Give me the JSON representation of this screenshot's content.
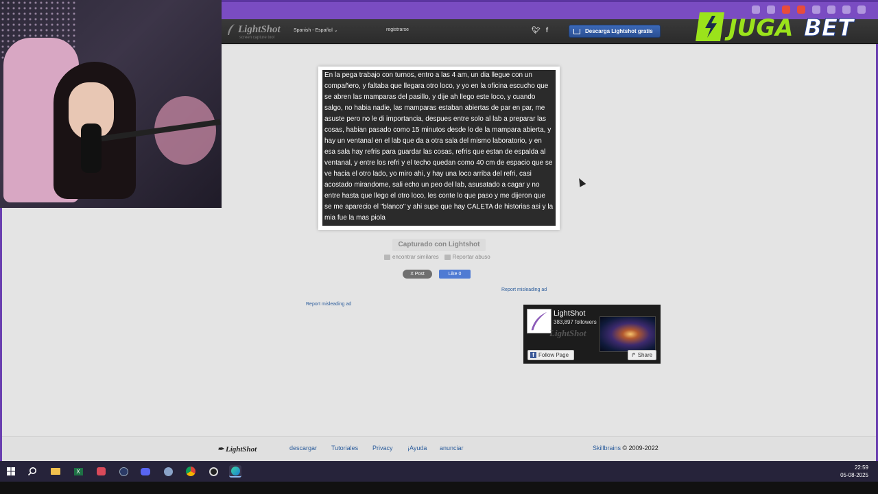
{
  "header": {
    "logo_name": "LightShot",
    "logo_sub": "screen capture tool",
    "language": "Spanish - Español",
    "register": "registrarse",
    "twitter_icon": "twitter-icon",
    "facebook_icon": "facebook-icon",
    "download_label": "Descarga Lightshot gratis"
  },
  "sponsor": {
    "name_left": "JUGA",
    "name_right": "BET"
  },
  "screenshot": {
    "text": "En la pega trabajo con turnos, entro a las 4 am, un dia llegue con un compañero, y faltaba que llegara otro loco, y  yo en la oficina escucho que se abren las mamparas del pasillo, y dije ah llego este loco, y cuando salgo, no habia nadie, las mamparas estaban abiertas de par en par, me asuste pero no le di importancia, despues entre solo al lab a preparar las cosas, habian pasado como 15 minutos desde lo de la mampara abierta,  y hay un ventanal en el lab que da a otra sala del mismo laboratorio, y en esa sala hay refris para guardar las cosas, refris que estan de espalda al ventanal, y entre los refri y el techo quedan como 40 cm de espacio que se ve hacia el otro lado,  yo miro ahi, y hay una loco arriba del refri, casi acostado mirandome, sali echo un peo del lab, asusatado a cagar  y no entre hasta que llego el otro loco, les conte lo que paso y me dijeron que se me aparecio el \"blanco\" y ahi supe que hay CALETA de historias asi y la mia fue la mas piola"
  },
  "captured_label": "Capturado con Lightshot",
  "actions": {
    "similar": "encontrar similares",
    "report": "Reportar abuso"
  },
  "social_buttons": {
    "x_post": "X Post",
    "fb_like": "Like 0"
  },
  "ads": {
    "report1": "Report misleading ad",
    "report2": "Report misleading ad"
  },
  "fb_page": {
    "name": "LightShot",
    "followers": "383,897 followers",
    "watermark": "LightShot",
    "follow": "Follow Page",
    "share": "Share"
  },
  "footer": {
    "logo": "LightShot",
    "links": [
      "descargar",
      "Tutoriales",
      "Privacy",
      "¡Ayuda",
      "anunciar"
    ],
    "company": "Skillbrains",
    "copyright": "© 2009-2022"
  },
  "taskbar": {
    "time": "22:59",
    "date": "05-08-2025",
    "apps": [
      "windows-icon",
      "search-icon",
      "file-explorer-icon",
      "excel-icon",
      "game-icon",
      "app-icon",
      "discord-icon",
      "browser-icon",
      "chrome-icon",
      "obs-icon",
      "edge-icon"
    ]
  },
  "colors": {
    "frame_purple": "#6a3fb0",
    "header_dark": "#2b2b2b",
    "download_blue": "#3c69b8",
    "page_grey": "#e4e4e4",
    "link_blue": "#2c5d9c",
    "jugabet_green": "#9be31b",
    "jugabet_blue": "#1f3d8f"
  }
}
